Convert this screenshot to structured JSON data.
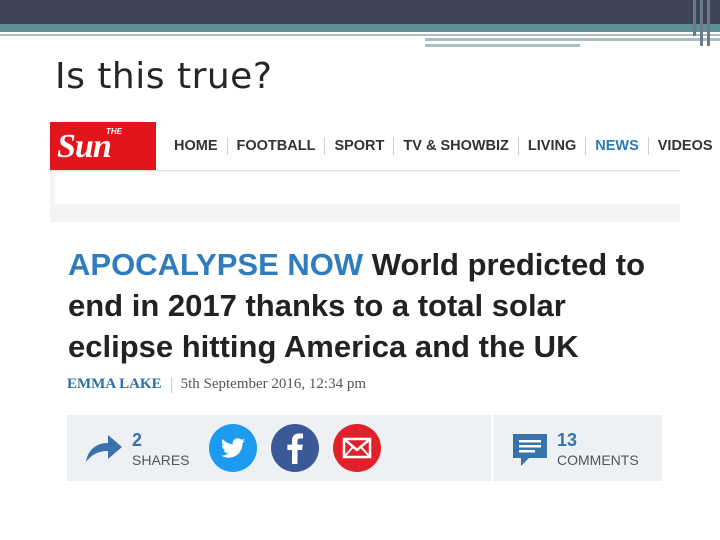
{
  "slide": {
    "title": "Is this true?"
  },
  "site": {
    "logo_small": "THE",
    "logo_text": "Sun",
    "nav": [
      "HOME",
      "FOOTBALL",
      "SPORT",
      "TV & SHOWBIZ",
      "LIVING",
      "NEWS",
      "VIDEOS"
    ],
    "active_nav": "NEWS",
    "brand_color": "#e3141b",
    "accent_color": "#2f7cbe"
  },
  "article": {
    "kicker": "APOCALYPSE NOW",
    "headline": "World predicted to end in 2017 thanks to a total solar eclipse hitting America and the UK",
    "author": "EMMA LAKE",
    "date": "5th September 2016, 12:34 pm"
  },
  "share": {
    "share_count": "2",
    "share_label": "SHARES",
    "comment_count": "13",
    "comment_label": "COMMENTS",
    "icons": [
      "share-arrow-icon",
      "twitter-icon",
      "facebook-icon",
      "email-icon",
      "comment-icon"
    ]
  }
}
